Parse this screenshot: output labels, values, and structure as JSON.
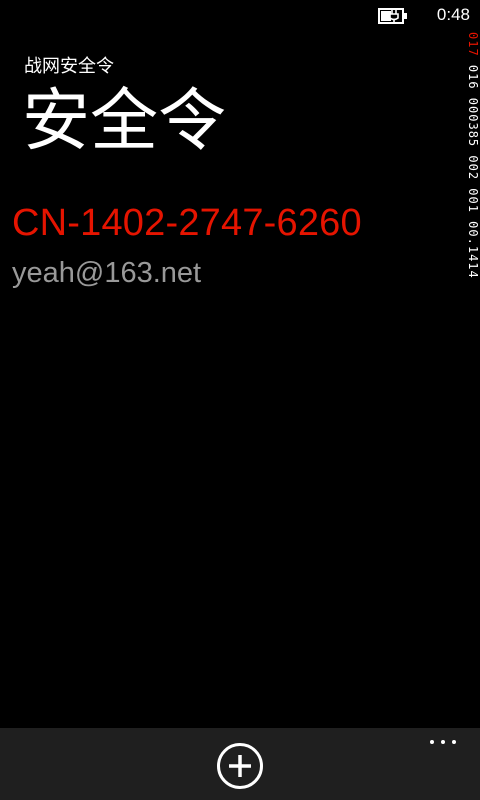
{
  "status_bar": {
    "time": "0:48",
    "battery_icon": "battery-charging-icon"
  },
  "debug_overlay": {
    "highlight_text": "017",
    "rest_text": " 016 000385 002 001 00.1414"
  },
  "app": {
    "name": "战网安全令",
    "page_title": "安全令"
  },
  "authenticator": {
    "serial": "CN-1402-2747-6260",
    "account": "yeah@163.net"
  },
  "app_bar": {
    "add_icon": "add-circle-icon",
    "more_icon": "ellipsis-icon"
  },
  "colors": {
    "accent": "#e51400",
    "secondary_text": "#999999",
    "background": "#000000",
    "app_bar": "#1f1f1f"
  }
}
